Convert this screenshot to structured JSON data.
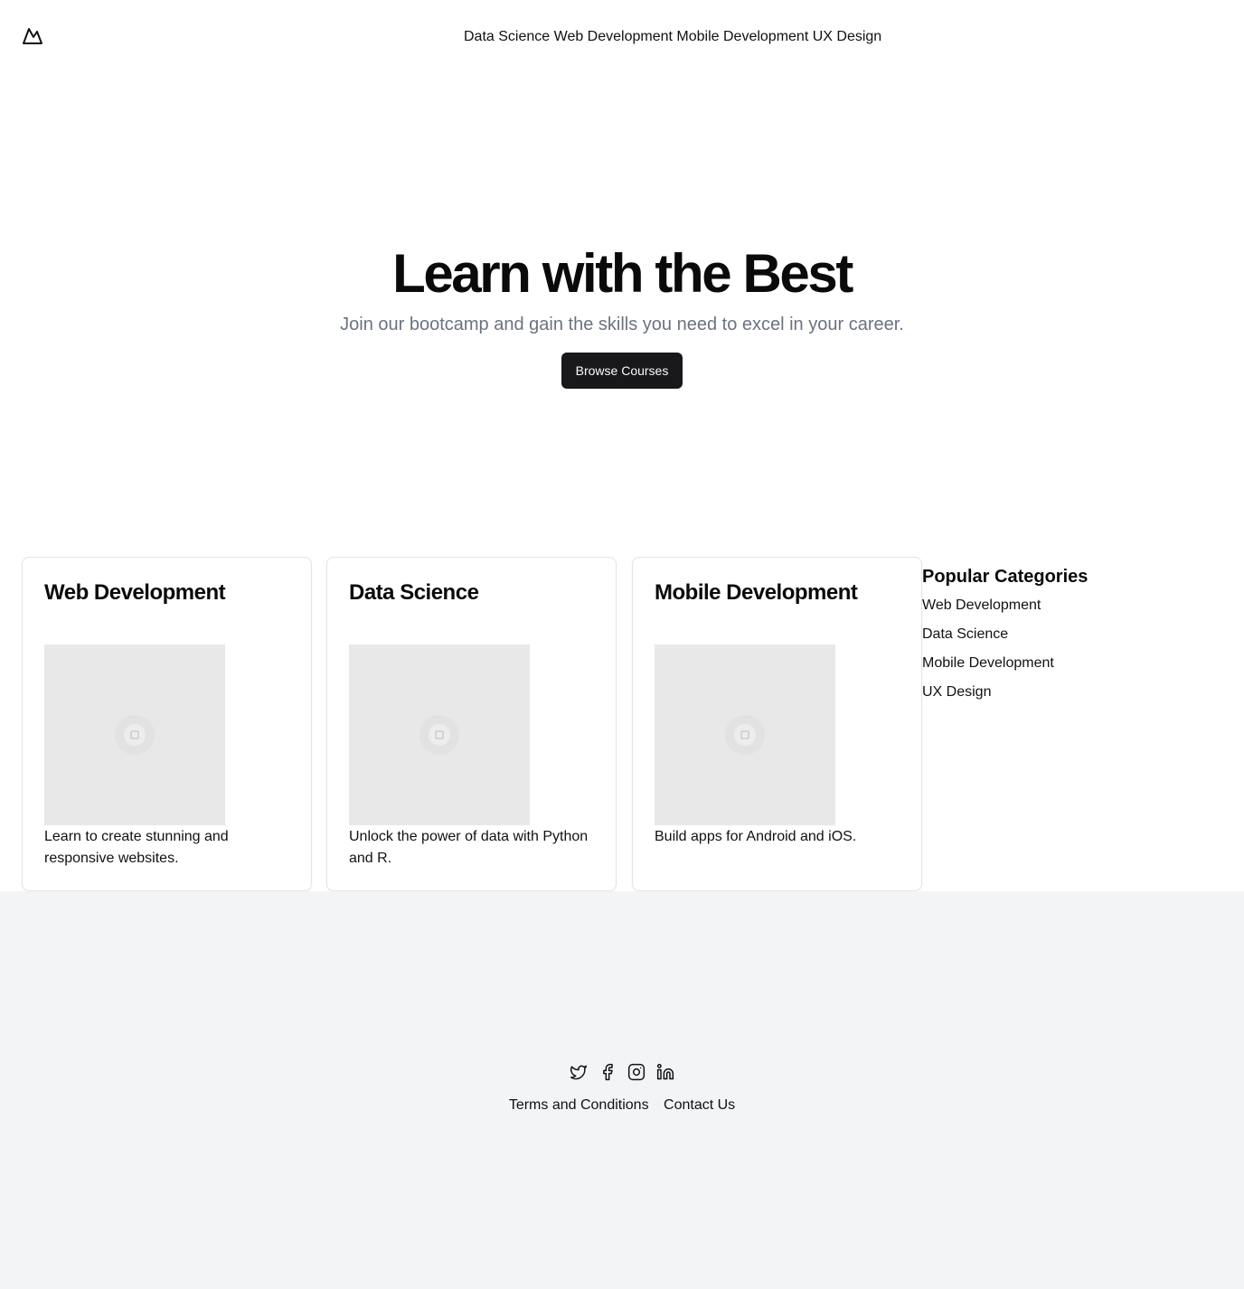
{
  "header": {
    "logo_icon": "mountain-icon",
    "nav": [
      "Data Science",
      "Web Development",
      "Mobile Development",
      "UX Design"
    ]
  },
  "hero": {
    "title": "Learn with the Best",
    "subtitle": "Join our bootcamp and gain the skills you need to excel in your career.",
    "cta_label": "Browse Courses"
  },
  "courses": [
    {
      "title": "Web Development",
      "description": "Learn to create stunning and responsive websites.",
      "image_icon": "image-placeholder-icon"
    },
    {
      "title": "Data Science",
      "description": "Unlock the power of data with Python and R.",
      "image_icon": "image-placeholder-icon"
    },
    {
      "title": "Mobile Development",
      "description": "Build apps for Android and iOS.",
      "image_icon": "image-placeholder-icon"
    }
  ],
  "sidebar": {
    "heading": "Popular Categories",
    "items": [
      "Web Development",
      "Data Science",
      "Mobile Development",
      "UX Design"
    ]
  },
  "footer": {
    "socials": [
      "twitter-icon",
      "facebook-icon",
      "instagram-icon",
      "linkedin-icon"
    ],
    "links": [
      "Terms and Conditions",
      "Contact Us"
    ]
  },
  "colors": {
    "primary_button": "#18181b",
    "muted_text": "#6b7280",
    "footer_bg": "#f3f4f6",
    "placeholder_bg": "#e8e8e8"
  }
}
